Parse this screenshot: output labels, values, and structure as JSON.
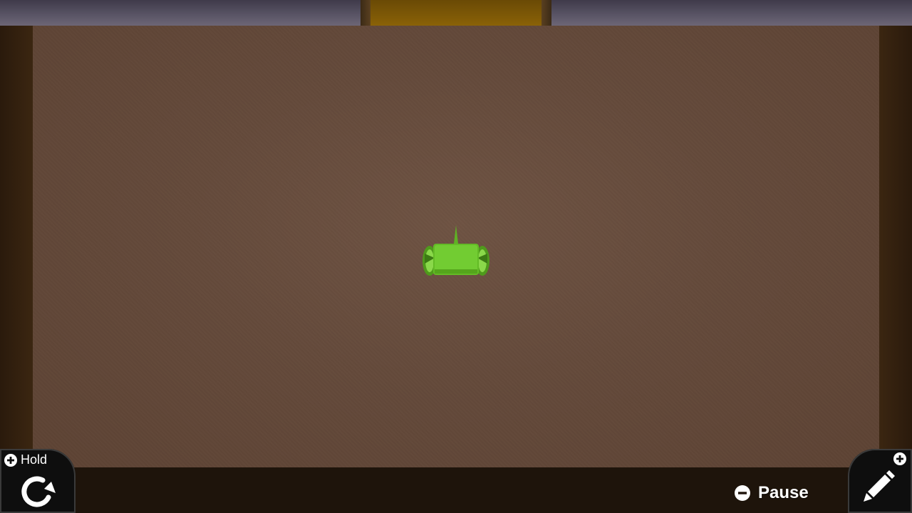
{
  "hud": {
    "hold": {
      "modifier_icon": "plus-circle-icon",
      "label": "Hold",
      "action_icon": "rotate-clockwise-icon"
    },
    "pause": {
      "modifier_icon": "minus-circle-icon",
      "label": "Pause"
    },
    "edit": {
      "modifier_icon": "plus-circle-icon",
      "action_icon": "pencil-icon"
    }
  },
  "scene": {
    "vehicle_color": "#6cc22a",
    "floor_color": "#644a3b",
    "gap_color": "#7a5606"
  }
}
